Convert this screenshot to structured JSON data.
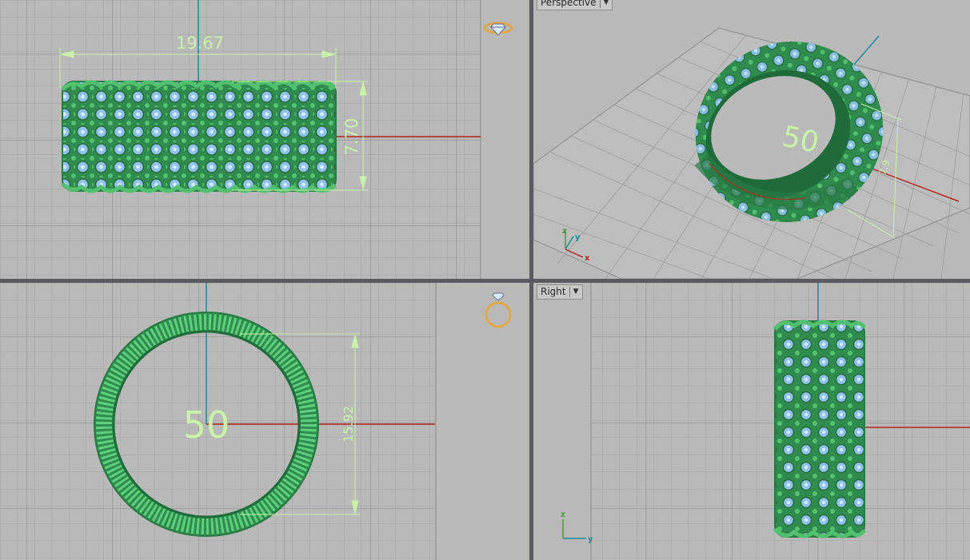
{
  "viewports": {
    "top_left": {
      "dimension_width": "19.67",
      "dimension_height": "7.70",
      "icon": "ring-gem-icon"
    },
    "top_right": {
      "title": "Perspective",
      "ring_size": "50",
      "dimension_small": "7.9",
      "axis_x": "x",
      "axis_y": "y",
      "axis_z": "z"
    },
    "bottom_left": {
      "ring_size": "50",
      "dimension_diameter": "15.92",
      "icon": "ring-outline-icon"
    },
    "bottom_right": {
      "title": "Right",
      "axis_y": "y",
      "axis_z": "z"
    }
  },
  "colors": {
    "viewport_bg": "#b9b9b9",
    "grid_minor": "#a4a4a4",
    "grid_major": "#8a8a8a",
    "axis_red": "#b3261e",
    "axis_teal": "#1d8a9a",
    "ring_green": "#3aa35c",
    "gem_blue": "#8fc3ee",
    "dim_green": "#c7f2a7",
    "frame": "#5a5a60"
  }
}
